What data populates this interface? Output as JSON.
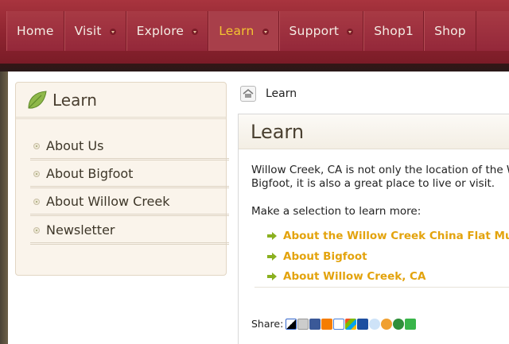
{
  "nav": {
    "items": [
      {
        "label": "Home",
        "dropdown": false,
        "active": false
      },
      {
        "label": "Visit",
        "dropdown": true,
        "active": false
      },
      {
        "label": "Explore",
        "dropdown": true,
        "active": false
      },
      {
        "label": "Learn",
        "dropdown": true,
        "active": true
      },
      {
        "label": "Support",
        "dropdown": true,
        "active": false
      },
      {
        "label": "Shop1",
        "dropdown": false,
        "active": false
      },
      {
        "label": "Shop",
        "dropdown": false,
        "active": false
      }
    ],
    "active_color": "#f4c430"
  },
  "sidebar": {
    "title": "Learn",
    "icon": "leaf-icon",
    "items": [
      {
        "label": "About Us"
      },
      {
        "label": "About Bigfoot"
      },
      {
        "label": "About Willow Creek"
      },
      {
        "label": "Newsletter"
      }
    ]
  },
  "breadcrumb": {
    "home_icon": "home-icon",
    "current": "Learn"
  },
  "main": {
    "title": "Learn",
    "intro_line1": "Willow Creek, CA is not only the location of the Will",
    "intro_line2": "Bigfoot, it is also a great place to live or visit.",
    "prompt": "Make a selection to learn more:",
    "links": [
      {
        "label": "About the Willow Creek China Flat Muse"
      },
      {
        "label": "About Bigfoot"
      },
      {
        "label": "About Willow Creek, CA"
      }
    ],
    "link_color": "#e3a30d"
  },
  "share": {
    "label": "Share:",
    "icons": [
      "delicious-icon",
      "digg-icon",
      "facebook-icon",
      "blogger-icon",
      "google-icon",
      "windows-live-icon",
      "myspace-icon",
      "reddit-icon",
      "slashdot-icon",
      "stumbleupon-icon",
      "technorati-icon"
    ]
  }
}
